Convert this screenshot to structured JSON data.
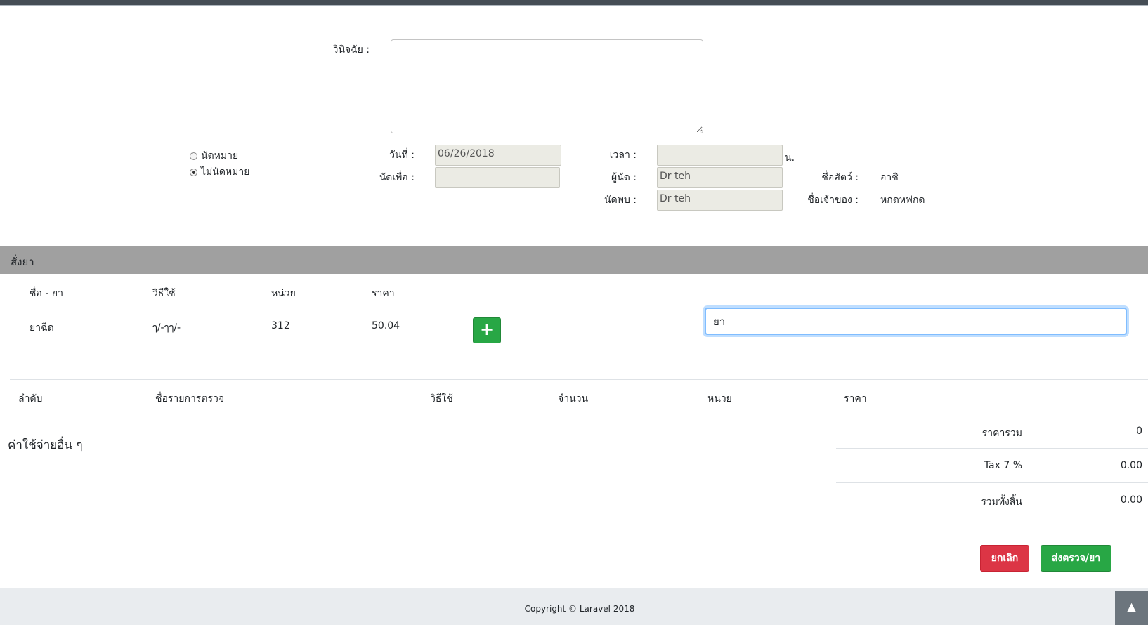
{
  "diagnosis": {
    "label": "วินิจฉัย :",
    "value": ""
  },
  "appointment": {
    "radio_make": "นัดหมาย",
    "radio_none": "ไม่นัดหมาย",
    "selected": "none",
    "date_label": "วันที่ :",
    "date_value": "06/26/2018",
    "purpose_label": "นัดเพื่อ :",
    "purpose_value": "",
    "time_label": "เวลา :",
    "time_value": "",
    "time_unit": "น.",
    "appointer_label": "ผู้นัด :",
    "appointer_value": "Dr teh",
    "meet_label": "นัดพบ :",
    "meet_value": "Dr teh"
  },
  "pet": {
    "name_label": "ชื่อสัตว์ :",
    "name_value": "อาชิ",
    "owner_label": "ชื่อเจ้าของ :",
    "owner_value": "หกดหฟกด"
  },
  "order_section": {
    "title": "สั่งยา"
  },
  "drug_table": {
    "headers": [
      "ชื่อ - ยา",
      "วิธีใช้",
      "หน่วย",
      "ราคา"
    ],
    "rows": [
      {
        "name": "ยาฉีด",
        "usage": "ๅ/-ๅๅ/-",
        "unit": "312",
        "price": "50.04"
      }
    ],
    "add_label": "+"
  },
  "search": {
    "value": "ยา"
  },
  "exam_table": {
    "headers": [
      "ลำดับ",
      "ชื่อรายการตรวจ",
      "วิธีใช้",
      "จำนวน",
      "หน่วย",
      "ราคา"
    ]
  },
  "other_expenses": {
    "title": "ค่าใช้จ่ายอื่น ๆ"
  },
  "summary": {
    "subtotal_label": "ราคารวม",
    "subtotal_value": "0",
    "tax_label": "Tax 7 %",
    "tax_value": "0.00",
    "total_label": "รวมทั้งสิ้น",
    "total_value": "0.00"
  },
  "buttons": {
    "cancel": "ยกเลิก",
    "submit": "ส่งตรวจ/ยา"
  },
  "footer": {
    "copyright": "Copyright © Laravel 2018"
  },
  "icons": {
    "scroll_top": "chevron-up-icon"
  },
  "colors": {
    "success": "#28a745",
    "danger": "#dc3545",
    "section": "#a0a0a0",
    "footer": "#e9ecef"
  }
}
